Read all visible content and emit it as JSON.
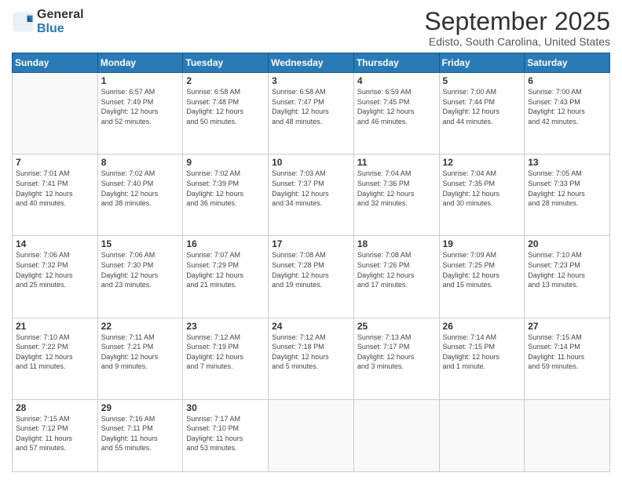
{
  "logo": {
    "general": "General",
    "blue": "Blue"
  },
  "header": {
    "title": "September 2025",
    "subtitle": "Edisto, South Carolina, United States"
  },
  "days_of_week": [
    "Sunday",
    "Monday",
    "Tuesday",
    "Wednesday",
    "Thursday",
    "Friday",
    "Saturday"
  ],
  "weeks": [
    [
      {
        "day": "",
        "detail": ""
      },
      {
        "day": "1",
        "detail": "Sunrise: 6:57 AM\nSunset: 7:49 PM\nDaylight: 12 hours\nand 52 minutes."
      },
      {
        "day": "2",
        "detail": "Sunrise: 6:58 AM\nSunset: 7:48 PM\nDaylight: 12 hours\nand 50 minutes."
      },
      {
        "day": "3",
        "detail": "Sunrise: 6:58 AM\nSunset: 7:47 PM\nDaylight: 12 hours\nand 48 minutes."
      },
      {
        "day": "4",
        "detail": "Sunrise: 6:59 AM\nSunset: 7:45 PM\nDaylight: 12 hours\nand 46 minutes."
      },
      {
        "day": "5",
        "detail": "Sunrise: 7:00 AM\nSunset: 7:44 PM\nDaylight: 12 hours\nand 44 minutes."
      },
      {
        "day": "6",
        "detail": "Sunrise: 7:00 AM\nSunset: 7:43 PM\nDaylight: 12 hours\nand 42 minutes."
      }
    ],
    [
      {
        "day": "7",
        "detail": "Sunrise: 7:01 AM\nSunset: 7:41 PM\nDaylight: 12 hours\nand 40 minutes."
      },
      {
        "day": "8",
        "detail": "Sunrise: 7:02 AM\nSunset: 7:40 PM\nDaylight: 12 hours\nand 38 minutes."
      },
      {
        "day": "9",
        "detail": "Sunrise: 7:02 AM\nSunset: 7:39 PM\nDaylight: 12 hours\nand 36 minutes."
      },
      {
        "day": "10",
        "detail": "Sunrise: 7:03 AM\nSunset: 7:37 PM\nDaylight: 12 hours\nand 34 minutes."
      },
      {
        "day": "11",
        "detail": "Sunrise: 7:04 AM\nSunset: 7:36 PM\nDaylight: 12 hours\nand 32 minutes."
      },
      {
        "day": "12",
        "detail": "Sunrise: 7:04 AM\nSunset: 7:35 PM\nDaylight: 12 hours\nand 30 minutes."
      },
      {
        "day": "13",
        "detail": "Sunrise: 7:05 AM\nSunset: 7:33 PM\nDaylight: 12 hours\nand 28 minutes."
      }
    ],
    [
      {
        "day": "14",
        "detail": "Sunrise: 7:06 AM\nSunset: 7:32 PM\nDaylight: 12 hours\nand 25 minutes."
      },
      {
        "day": "15",
        "detail": "Sunrise: 7:06 AM\nSunset: 7:30 PM\nDaylight: 12 hours\nand 23 minutes."
      },
      {
        "day": "16",
        "detail": "Sunrise: 7:07 AM\nSunset: 7:29 PM\nDaylight: 12 hours\nand 21 minutes."
      },
      {
        "day": "17",
        "detail": "Sunrise: 7:08 AM\nSunset: 7:28 PM\nDaylight: 12 hours\nand 19 minutes."
      },
      {
        "day": "18",
        "detail": "Sunrise: 7:08 AM\nSunset: 7:26 PM\nDaylight: 12 hours\nand 17 minutes."
      },
      {
        "day": "19",
        "detail": "Sunrise: 7:09 AM\nSunset: 7:25 PM\nDaylight: 12 hours\nand 15 minutes."
      },
      {
        "day": "20",
        "detail": "Sunrise: 7:10 AM\nSunset: 7:23 PM\nDaylight: 12 hours\nand 13 minutes."
      }
    ],
    [
      {
        "day": "21",
        "detail": "Sunrise: 7:10 AM\nSunset: 7:22 PM\nDaylight: 12 hours\nand 11 minutes."
      },
      {
        "day": "22",
        "detail": "Sunrise: 7:11 AM\nSunset: 7:21 PM\nDaylight: 12 hours\nand 9 minutes."
      },
      {
        "day": "23",
        "detail": "Sunrise: 7:12 AM\nSunset: 7:19 PM\nDaylight: 12 hours\nand 7 minutes."
      },
      {
        "day": "24",
        "detail": "Sunrise: 7:12 AM\nSunset: 7:18 PM\nDaylight: 12 hours\nand 5 minutes."
      },
      {
        "day": "25",
        "detail": "Sunrise: 7:13 AM\nSunset: 7:17 PM\nDaylight: 12 hours\nand 3 minutes."
      },
      {
        "day": "26",
        "detail": "Sunrise: 7:14 AM\nSunset: 7:15 PM\nDaylight: 12 hours\nand 1 minute."
      },
      {
        "day": "27",
        "detail": "Sunrise: 7:15 AM\nSunset: 7:14 PM\nDaylight: 11 hours\nand 59 minutes."
      }
    ],
    [
      {
        "day": "28",
        "detail": "Sunrise: 7:15 AM\nSunset: 7:12 PM\nDaylight: 11 hours\nand 57 minutes."
      },
      {
        "day": "29",
        "detail": "Sunrise: 7:16 AM\nSunset: 7:11 PM\nDaylight: 11 hours\nand 55 minutes."
      },
      {
        "day": "30",
        "detail": "Sunrise: 7:17 AM\nSunset: 7:10 PM\nDaylight: 11 hours\nand 53 minutes."
      },
      {
        "day": "",
        "detail": ""
      },
      {
        "day": "",
        "detail": ""
      },
      {
        "day": "",
        "detail": ""
      },
      {
        "day": "",
        "detail": ""
      }
    ]
  ]
}
